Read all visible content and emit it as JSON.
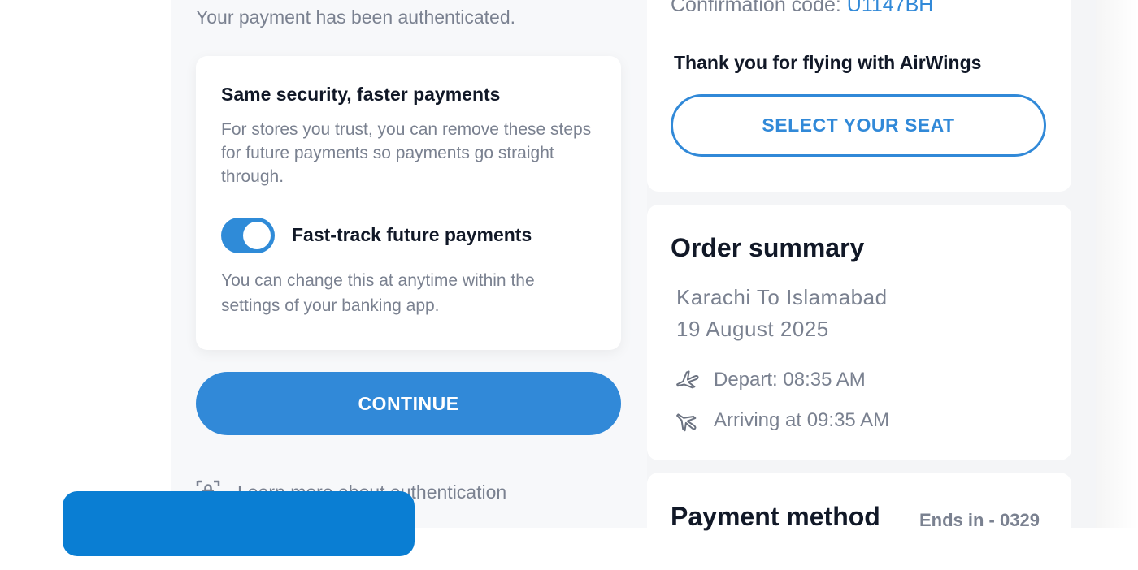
{
  "auth": {
    "message": "Your payment has been authenticated."
  },
  "info_card": {
    "title": "Same security, faster payments",
    "description": "For stores you trust, you can remove these steps for future payments so payments go straight through.",
    "toggle_label": "Fast-track future payments",
    "toggle_on": true,
    "hint": "You can change this at anytime within the settings of your banking app."
  },
  "continue_label": "CONTINUE",
  "learn_more": {
    "label": "Learn more about authentication",
    "icon": "lock-icon"
  },
  "confirmation": {
    "label": "Confirmation code:",
    "code": "U1147BH"
  },
  "thanks": "Thank you for flying with AirWings",
  "select_seat_label": "SELECT YOUR SEAT",
  "order_summary": {
    "title": "Order summary",
    "route": "Karachi To Islamabad",
    "date": "19 August 2025",
    "depart": "Depart: 08:35 AM",
    "arrive": "Arriving at 09:35 AM",
    "depart_icon": "plane-takeoff-icon",
    "arrive_icon": "plane-landing-icon"
  },
  "payment": {
    "title": "Payment method",
    "ends_in": "Ends in - 0329"
  },
  "colors": {
    "accent": "#3189d8",
    "overlay": "#0a7ed3",
    "muted_text": "#7a8190",
    "heading_text": "#111827"
  }
}
